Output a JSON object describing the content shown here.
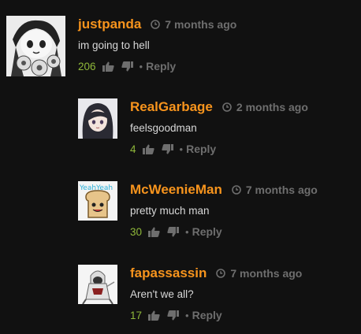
{
  "comments": [
    {
      "username": "justpanda",
      "time": "7 months ago",
      "text": "im going to hell",
      "votes": "206",
      "reply_label": "Reply",
      "avatar": "anime-girl-avatar"
    },
    {
      "username": "RealGarbage",
      "time": "2 months ago",
      "text": "feelsgoodman",
      "votes": "4",
      "reply_label": "Reply",
      "avatar": "dark-hair-girl-avatar"
    },
    {
      "username": "McWeenieMan",
      "time": "7 months ago",
      "text": "pretty much man",
      "votes": "30",
      "reply_label": "Reply",
      "avatar": "toast-cartoon-avatar"
    },
    {
      "username": "fapassassin",
      "time": "7 months ago",
      "text": "Aren't we all?",
      "votes": "17",
      "reply_label": "Reply",
      "avatar": "hooded-assassin-avatar"
    }
  ],
  "colors": {
    "background": "#111111",
    "username": "#f7941d",
    "muted": "#6e6e6e",
    "votes": "#8fb83a",
    "text": "#d8d8d8"
  }
}
